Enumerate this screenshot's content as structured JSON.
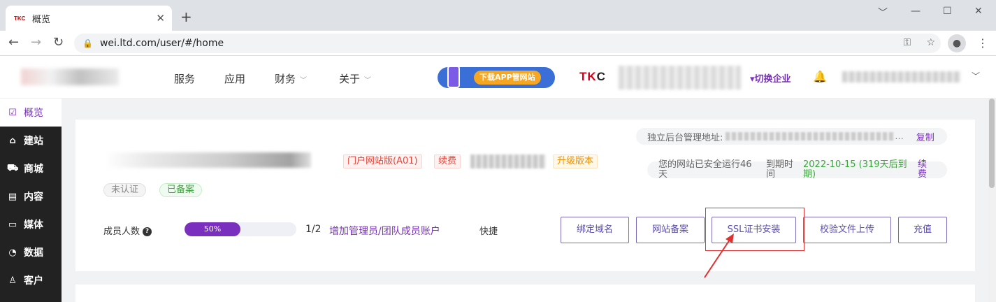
{
  "browser": {
    "tab_favicon": "TKC",
    "tab_title": "概览",
    "tab_close": "✕",
    "new_tab": "+",
    "url": "wei.ltd.com/user/#/home"
  },
  "header": {
    "nav": [
      {
        "label": "服务",
        "caret": ""
      },
      {
        "label": "应用",
        "caret": ""
      },
      {
        "label": "财务",
        "caret": "﹀"
      },
      {
        "label": "关于",
        "caret": "﹀"
      }
    ],
    "app_banner": "下载APP管网站",
    "brand_prefix": "TK",
    "brand_suffix": "C",
    "switch_company": "▾切换企业"
  },
  "sidebar": {
    "items": [
      {
        "label": "概览",
        "icon": "chart-icon"
      },
      {
        "label": "建站",
        "icon": "home-icon"
      },
      {
        "label": "商城",
        "icon": "cart-icon"
      },
      {
        "label": "内容",
        "icon": "document-icon"
      },
      {
        "label": "媒体",
        "icon": "video-icon"
      },
      {
        "label": "数据",
        "icon": "pie-icon"
      },
      {
        "label": "客户",
        "icon": "user-icon"
      }
    ]
  },
  "site": {
    "tags": {
      "edition": "门户网站版(A01)",
      "renew": "续费",
      "upgrade": "升级版本",
      "unverified": "未认证",
      "filed": "已备案"
    },
    "admin_label": "独立后台管理地址:",
    "admin_ellipsis": "...",
    "copy": "复制",
    "running": "您的网站已安全运行46 天",
    "expire_label": "到期时间",
    "expire_date": "2022-10-15 (319天后到期)",
    "renew_link": "续费"
  },
  "members": {
    "label": "成员人数",
    "help": "?",
    "progress_percent": 50,
    "progress_text": "50%",
    "count": "1/2",
    "add_link": "增加管理员/团队成员账户",
    "quick": "快捷"
  },
  "actions": [
    {
      "label": "绑定域名"
    },
    {
      "label": "网站备案"
    },
    {
      "label": "SSL证书安装"
    },
    {
      "label": "校验文件上传"
    },
    {
      "label": "充值"
    }
  ],
  "colors": {
    "accent": "#7b2fbe",
    "highlight": "#e03030",
    "sidebar_bg": "#222222"
  }
}
